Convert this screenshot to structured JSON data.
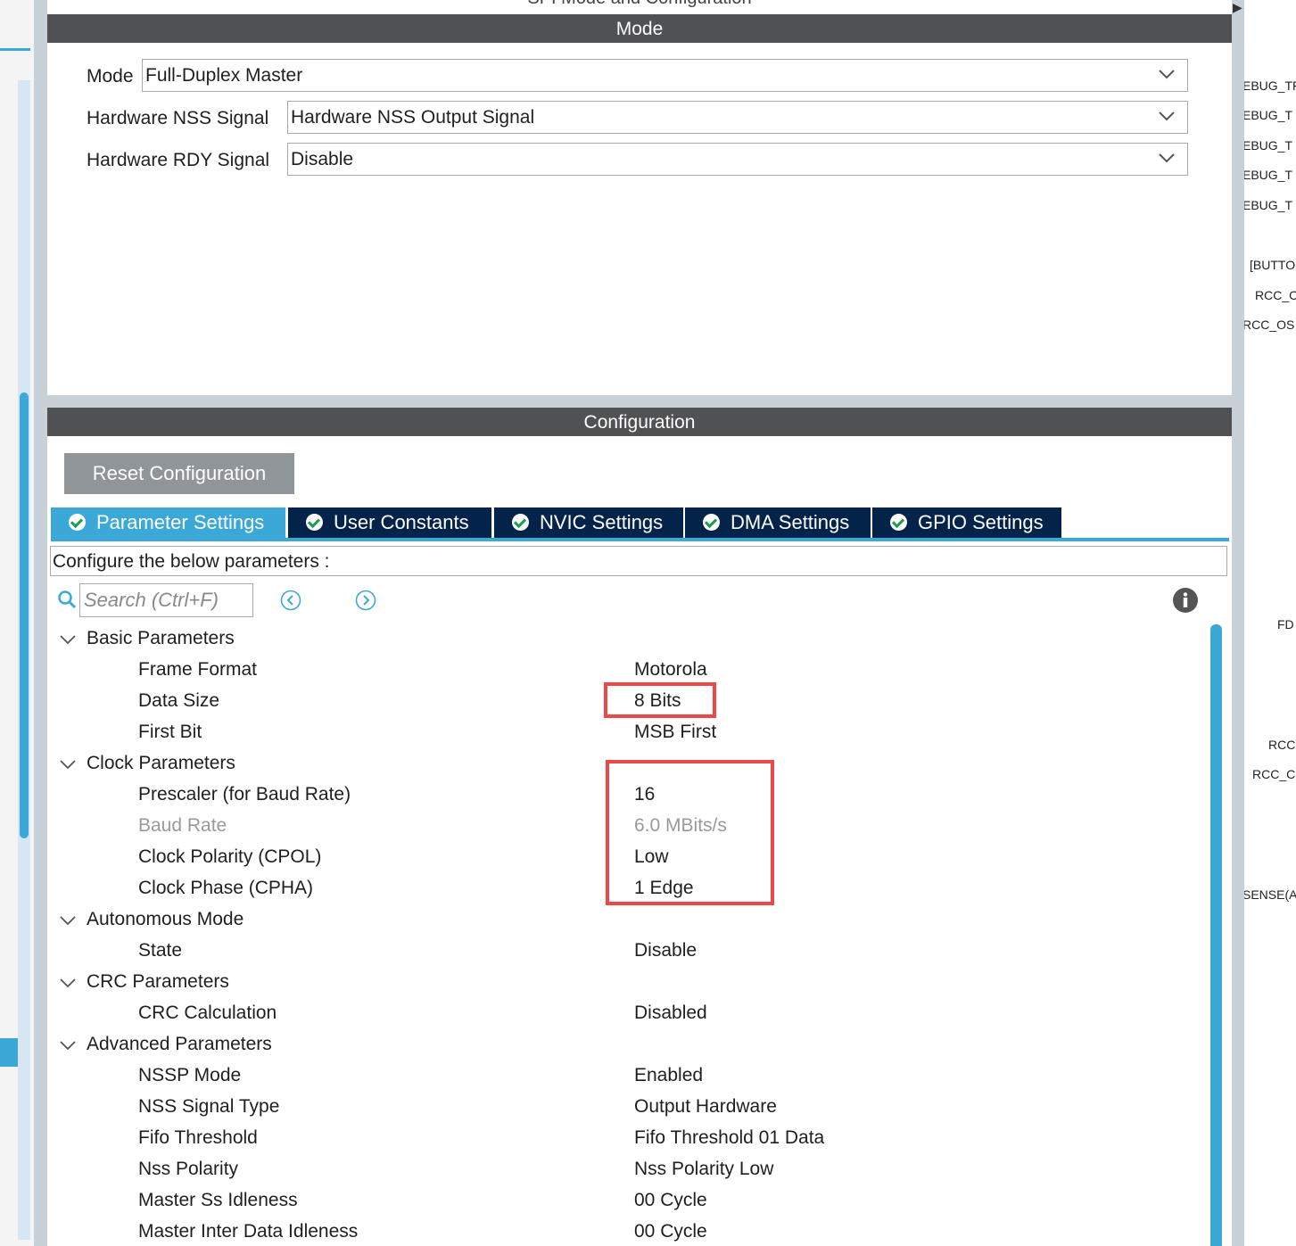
{
  "window": {
    "title": "SPI Mode and Configuration"
  },
  "mode": {
    "header": "Mode",
    "fields": [
      {
        "label": "Mode",
        "value": "Full-Duplex Master"
      },
      {
        "label": "Hardware NSS Signal",
        "value": "Hardware NSS Output Signal"
      },
      {
        "label": "Hardware RDY Signal",
        "value": "Disable"
      }
    ]
  },
  "configuration": {
    "header": "Configuration",
    "reset_label": "Reset Configuration",
    "tabs": [
      {
        "label": "Parameter Settings",
        "active": true
      },
      {
        "label": "User Constants",
        "active": false
      },
      {
        "label": "NVIC Settings",
        "active": false
      },
      {
        "label": "DMA Settings",
        "active": false
      },
      {
        "label": "GPIO Settings",
        "active": false
      }
    ],
    "instructions": "Configure the below parameters :",
    "search_placeholder": "Search (Ctrl+F)",
    "groups": [
      {
        "name": "Basic Parameters",
        "params": [
          {
            "label": "Frame Format",
            "value": "Motorola"
          },
          {
            "label": "Data Size",
            "value": "8 Bits"
          },
          {
            "label": "First Bit",
            "value": "MSB First"
          }
        ]
      },
      {
        "name": "Clock Parameters",
        "params": [
          {
            "label": "Prescaler (for Baud Rate)",
            "value": "16"
          },
          {
            "label": "Baud Rate",
            "value": "6.0 MBits/s"
          },
          {
            "label": "Clock Polarity (CPOL)",
            "value": "Low"
          },
          {
            "label": "Clock Phase (CPHA)",
            "value": "1 Edge"
          }
        ]
      },
      {
        "name": "Autonomous Mode",
        "params": [
          {
            "label": "State",
            "value": "Disable"
          }
        ]
      },
      {
        "name": "CRC Parameters",
        "params": [
          {
            "label": "CRC Calculation",
            "value": "Disabled"
          }
        ]
      },
      {
        "name": "Advanced Parameters",
        "params": [
          {
            "label": "NSSP Mode",
            "value": "Enabled"
          },
          {
            "label": "NSS Signal Type",
            "value": "Output Hardware"
          },
          {
            "label": "Fifo Threshold",
            "value": "Fifo Threshold 01 Data"
          },
          {
            "label": "Nss Polarity",
            "value": "Nss Polarity Low"
          },
          {
            "label": "Master Ss Idleness",
            "value": "00 Cycle"
          },
          {
            "label": "Master Inter Data Idleness",
            "value": "00 Cycle"
          }
        ]
      }
    ]
  },
  "right_labels": [
    "EBUG_TF",
    "EBUG_T",
    "EBUG_T",
    "EBUG_T",
    "EBUG_T",
    "[BUTTO",
    "RCC_C",
    "RCC_OS",
    "FD",
    "RCC",
    "RCC_C",
    "SENSE(A"
  ],
  "colors": {
    "accent": "#3ca8d8",
    "header": "#505152",
    "tab_inactive": "#03234b",
    "highlight": "#ec4848"
  }
}
